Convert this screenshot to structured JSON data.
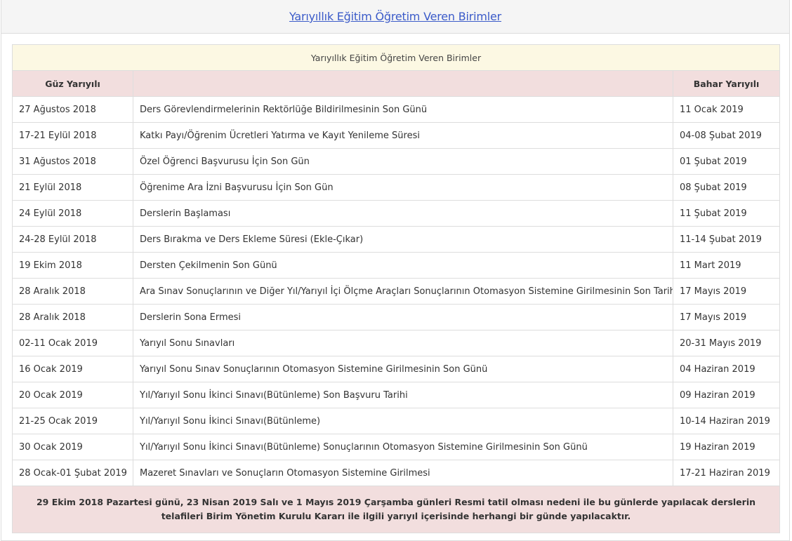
{
  "page": {
    "heading_link": "Yarıyıllık Eğitim Öğretim Veren Birimler"
  },
  "table": {
    "caption": "Yarıyıllık Eğitim Öğretim Veren Birimler",
    "columns": [
      "Güz Yarıyılı",
      "",
      "Bahar Yarıyılı"
    ],
    "rows": [
      {
        "fall": "27 Ağustos 2018",
        "event": "Ders Görevlendirmelerinin Rektörlüğe Bildirilmesinin Son Günü",
        "spring": "11 Ocak 2019"
      },
      {
        "fall": "17-21 Eylül 2018",
        "event": "Katkı Payı/Öğrenim Ücretleri Yatırma ve Kayıt Yenileme Süresi",
        "spring": "04-08 Şubat 2019"
      },
      {
        "fall": "31 Ağustos 2018",
        "event": "Özel Öğrenci Başvurusu İçin Son Gün",
        "spring": "01 Şubat 2019"
      },
      {
        "fall": "21 Eylül 2018",
        "event": "Öğrenime Ara İzni Başvurusu İçin Son Gün",
        "spring": "08 Şubat 2019"
      },
      {
        "fall": "24 Eylül 2018",
        "event": "Derslerin Başlaması",
        "spring": "11 Şubat 2019"
      },
      {
        "fall": "24-28 Eylül 2018",
        "event": "Ders Bırakma ve Ders Ekleme Süresi (Ekle-Çıkar)",
        "spring": "11-14 Şubat 2019"
      },
      {
        "fall": "19 Ekim 2018",
        "event": "Dersten Çekilmenin Son Günü",
        "spring": "11 Mart 2019"
      },
      {
        "fall": "28 Aralık 2018",
        "event": "Ara Sınav Sonuçlarının ve Diğer Yıl/Yarıyıl İçi Ölçme Araçları Sonuçlarının Otomasyon Sistemine Girilmesinin Son Tarihi",
        "spring": "17 Mayıs 2019"
      },
      {
        "fall": "28 Aralık 2018",
        "event": "Derslerin Sona Ermesi",
        "spring": "17 Mayıs 2019"
      },
      {
        "fall": "02-11 Ocak 2019",
        "event": "Yarıyıl Sonu Sınavları",
        "spring": "20-31 Mayıs 2019"
      },
      {
        "fall": "16 Ocak 2019",
        "event": "Yarıyıl Sonu Sınav Sonuçlarının Otomasyon Sistemine Girilmesinin Son Günü",
        "spring": "04 Haziran 2019"
      },
      {
        "fall": "20 Ocak 2019",
        "event": "Yıl/Yarıyıl Sonu İkinci Sınavı(Bütünleme) Son Başvuru Tarihi",
        "spring": "09 Haziran 2019"
      },
      {
        "fall": "21-25 Ocak 2019",
        "event": "Yıl/Yarıyıl Sonu İkinci Sınavı(Bütünleme)",
        "spring": "10-14 Haziran 2019"
      },
      {
        "fall": "30 Ocak 2019",
        "event": "Yıl/Yarıyıl Sonu İkinci Sınavı(Bütünleme) Sonuçlarının Otomasyon Sistemine Girilmesinin Son Günü",
        "spring": "19 Haziran 2019"
      },
      {
        "fall": "28 Ocak-01 Şubat 2019",
        "event": "Mazeret Sınavları ve Sonuçların Otomasyon Sistemine Girilmesi",
        "spring": "17-21 Haziran 2019"
      }
    ],
    "footnote": "29 Ekim 2018 Pazartesi günü, 23 Nisan 2019 Salı ve 1 Mayıs 2019 Çarşamba günleri Resmi tatil olması nedeni ile bu günlerde yapılacak derslerin telafileri Birim Yönetim Kurulu Kararı ile ilgili yarıyıl içerisinde herhangi bir günde yapılacaktır."
  },
  "colors": {
    "link": "#3b5bc9",
    "caption_bg": "#fcf8e3",
    "header_bg": "#f2dede",
    "border": "#dddddd"
  }
}
